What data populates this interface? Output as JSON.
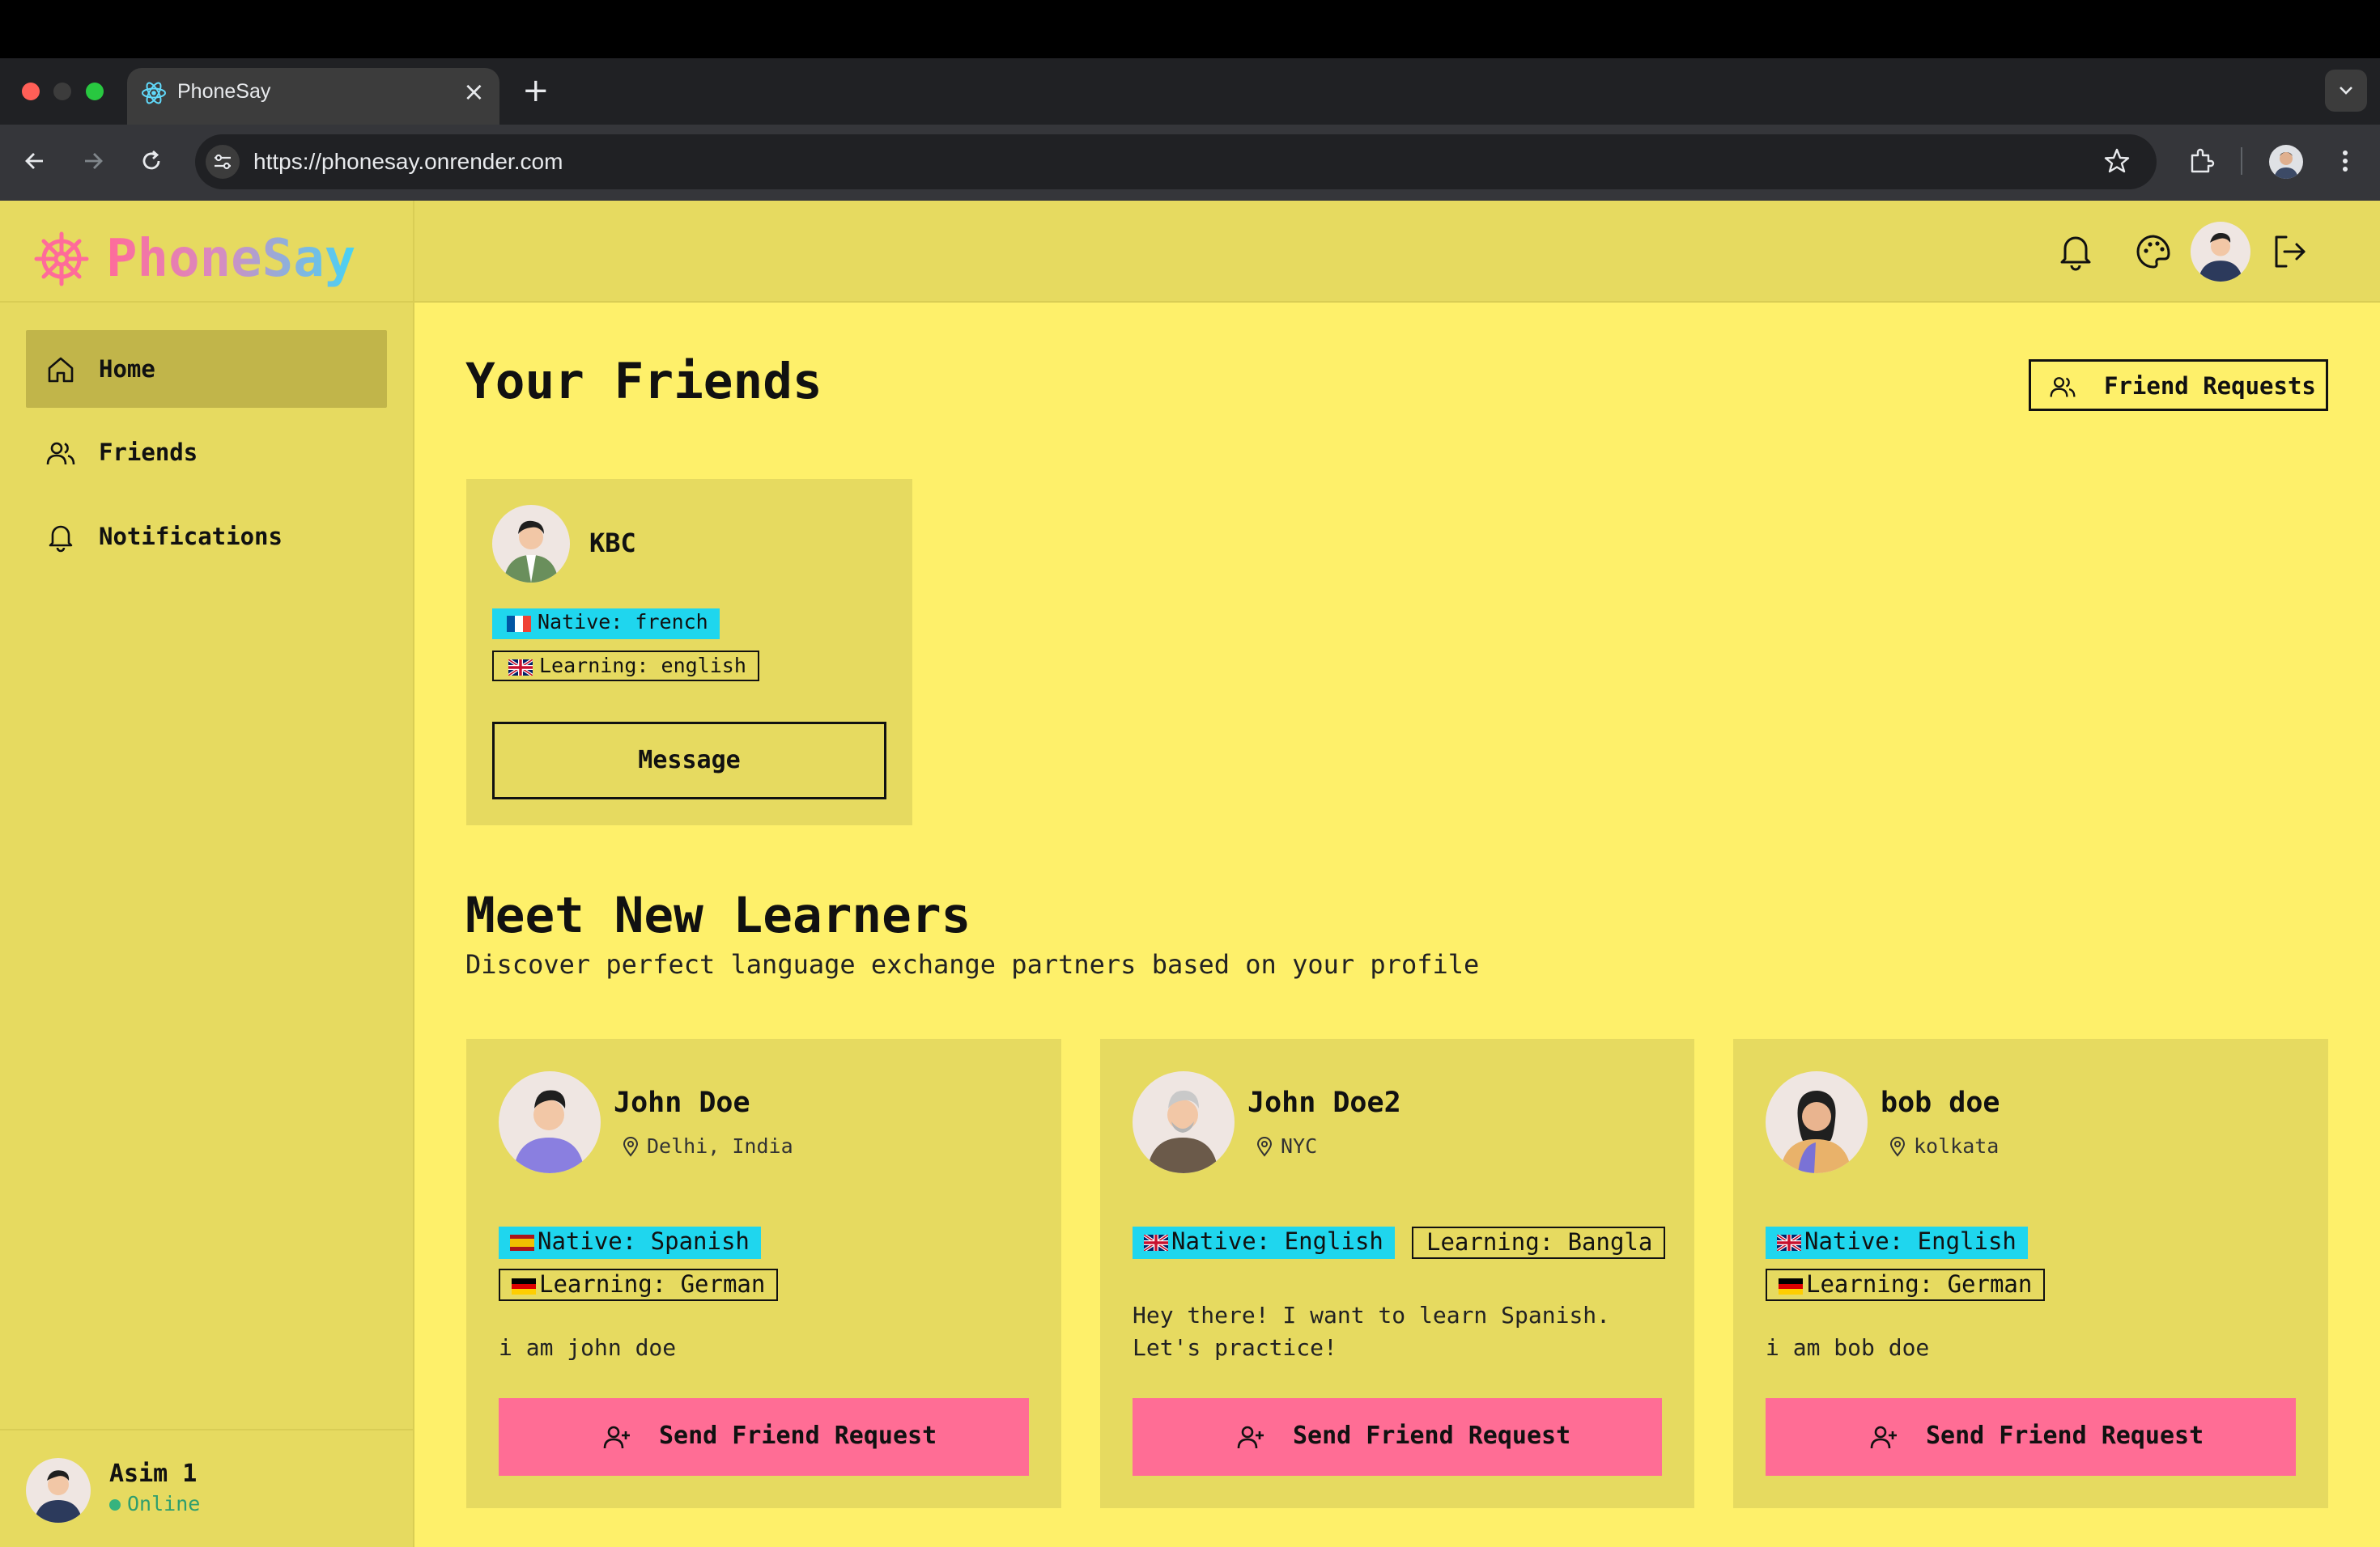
{
  "browser": {
    "tab_title": "PhoneSay",
    "url": "https://phonesay.onrender.com"
  },
  "app": {
    "brand": "PhoneSay",
    "accent_pink": "#ff6d95",
    "accent_cyan": "#1fd6ee",
    "background": "#fef06a"
  },
  "sidebar": {
    "items": [
      {
        "label": "Home",
        "icon": "home-icon",
        "active": true
      },
      {
        "label": "Friends",
        "icon": "users-icon"
      },
      {
        "label": "Notifications",
        "icon": "bell-icon"
      }
    ],
    "user": {
      "name": "Asim 1",
      "status": "Online"
    }
  },
  "friends_section": {
    "title": "Your Friends",
    "requests_button": "Friend Requests",
    "friends": [
      {
        "name": "KBC",
        "native": "Native: french",
        "learning": "Learning: english",
        "button": "Message"
      }
    ]
  },
  "learners_section": {
    "title": "Meet New Learners",
    "subtitle": "Discover perfect language exchange partners based on your profile",
    "learners": [
      {
        "name": "John Doe",
        "location": "Delhi, India",
        "native": "Native: Spanish",
        "learning": "Learning: German",
        "bio": "i am john doe",
        "button": "Send Friend Request"
      },
      {
        "name": "John Doe2",
        "location": "NYC",
        "native": "Native: English",
        "learning": "Learning: Bangla",
        "bio": "Hey there! I want to learn Spanish.\nLet's practice!",
        "button": "Send Friend Request"
      },
      {
        "name": "bob doe",
        "location": "kolkata",
        "native": "Native: English",
        "learning": "Learning: German",
        "bio": "i am bob doe",
        "button": "Send Friend Request"
      }
    ]
  }
}
